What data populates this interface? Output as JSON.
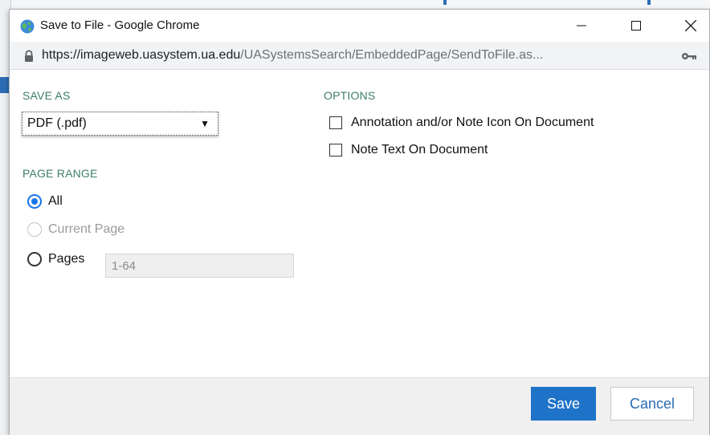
{
  "window": {
    "title": "Save to File - Google Chrome",
    "url_host": "https://imageweb.uasystem.ua.edu",
    "url_path": "/UASystemsSearch/EmbeddedPage/SendToFile.as..."
  },
  "save_as": {
    "label": "SAVE AS",
    "selected": "PDF (.pdf)",
    "arrow": "▼"
  },
  "page_range": {
    "label": "PAGE RANGE",
    "options": [
      {
        "label": "All",
        "checked": true,
        "disabled": false
      },
      {
        "label": "Current Page",
        "checked": false,
        "disabled": true
      },
      {
        "label": "Pages",
        "checked": false,
        "disabled": false
      }
    ],
    "pages_value": "1-64"
  },
  "options": {
    "label": "OPTIONS",
    "items": [
      {
        "label": "Annotation and/or Note Icon On Document",
        "checked": false
      },
      {
        "label": "Note Text On Document",
        "checked": false
      }
    ]
  },
  "footer": {
    "save_label": "Save",
    "cancel_label": "Cancel"
  },
  "colors": {
    "section_label": "#3d7d6a",
    "primary": "#1e73c8",
    "radio_checked": "#1a73e8"
  },
  "icons": {
    "app": "chrome-globe-icon",
    "lock": "lock-icon",
    "key": "key-icon",
    "minimize": "minimize-icon",
    "maximize": "maximize-icon",
    "close": "close-icon"
  }
}
